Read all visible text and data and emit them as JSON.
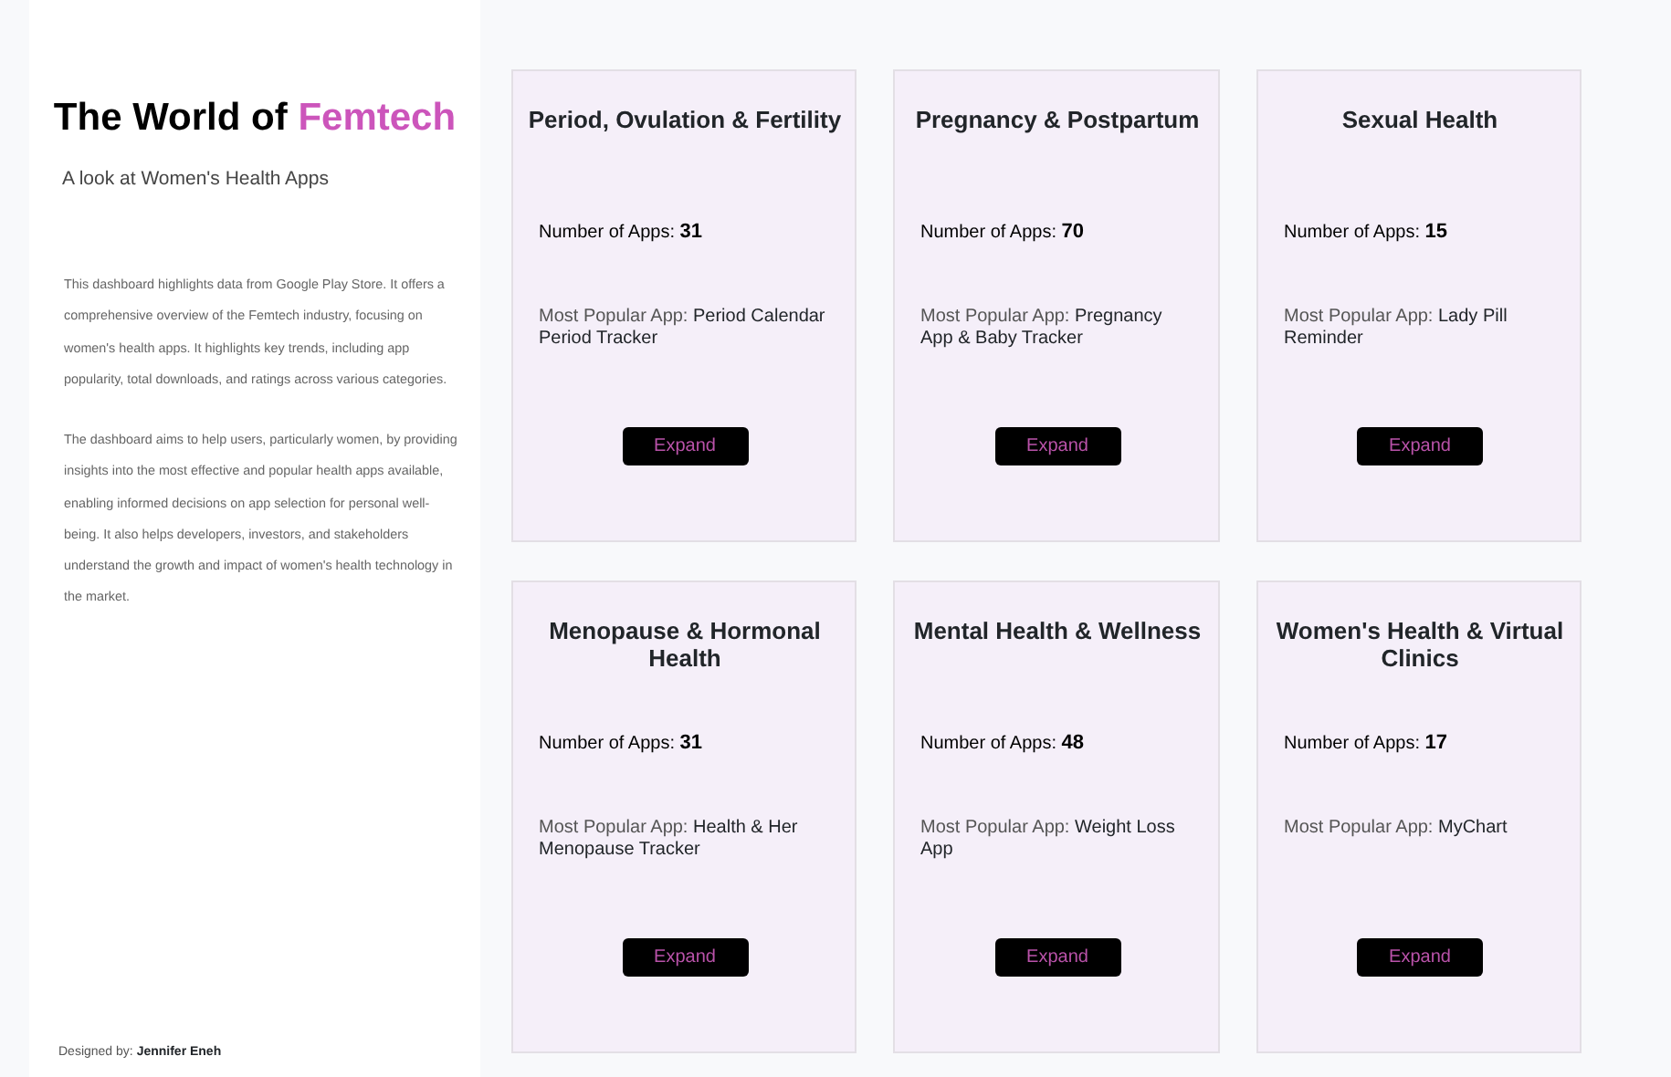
{
  "sidebar": {
    "title": "The World of",
    "title_highlight": "Femtech",
    "subtitle": "A look at Women's Health Apps",
    "paragraphs": [
      "This dashboard highlights data from Google Play Store. It offers a comprehensive overview of the Femtech industry, focusing on women's health apps. It highlights key trends, including app popularity, total downloads, and ratings across various categories.",
      "The dashboard aims to help users, particularly women, by providing insights into the most effective and popular health apps available, enabling informed decisions on app selection for personal well-being. It also helps developers, investors, and stakeholders understand the growth and impact of women's health technology in the market."
    ],
    "credit_label": "Designed by:",
    "credit_name": "Jennifer Eneh"
  },
  "cards": [
    {
      "title": "Period, Ovulation & Fertility",
      "apps": "Number of Apps: **31**",
      "popular_label": "Most Popular App:",
      "popular_value": "Period Calendar Period Tracker",
      "button": "Expand"
    },
    {
      "title": "Pregnancy & Postpartum",
      "apps": "Number of Apps: **70**",
      "popular_label": "Most Popular App:",
      "popular_value": "Pregnancy App & Baby Tracker",
      "button": "Expand"
    },
    {
      "title": "Sexual Health",
      "apps": "Number of Apps: **15**",
      "popular_label": "Most Popular App:",
      "popular_value": "Lady Pill Reminder",
      "button": "Expand"
    },
    {
      "title": "Menopause & Hormonal Health",
      "apps": "Number of Apps: **31**",
      "popular_label": "Most Popular App:",
      "popular_value": "Health & Her Menopause Tracker",
      "button": "Expand"
    },
    {
      "title": "Mental Health & Wellness",
      "apps": "Number of Apps: **48**",
      "popular_label": "Most Popular App:",
      "popular_value": "Weight Loss App",
      "button": "Expand"
    },
    {
      "title": "Women's Health & Virtual Clinics",
      "apps": "Number of Apps: **17**",
      "popular_label": "Most Popular App:",
      "popular_value": "MyChart",
      "button": "Expand"
    }
  ]
}
